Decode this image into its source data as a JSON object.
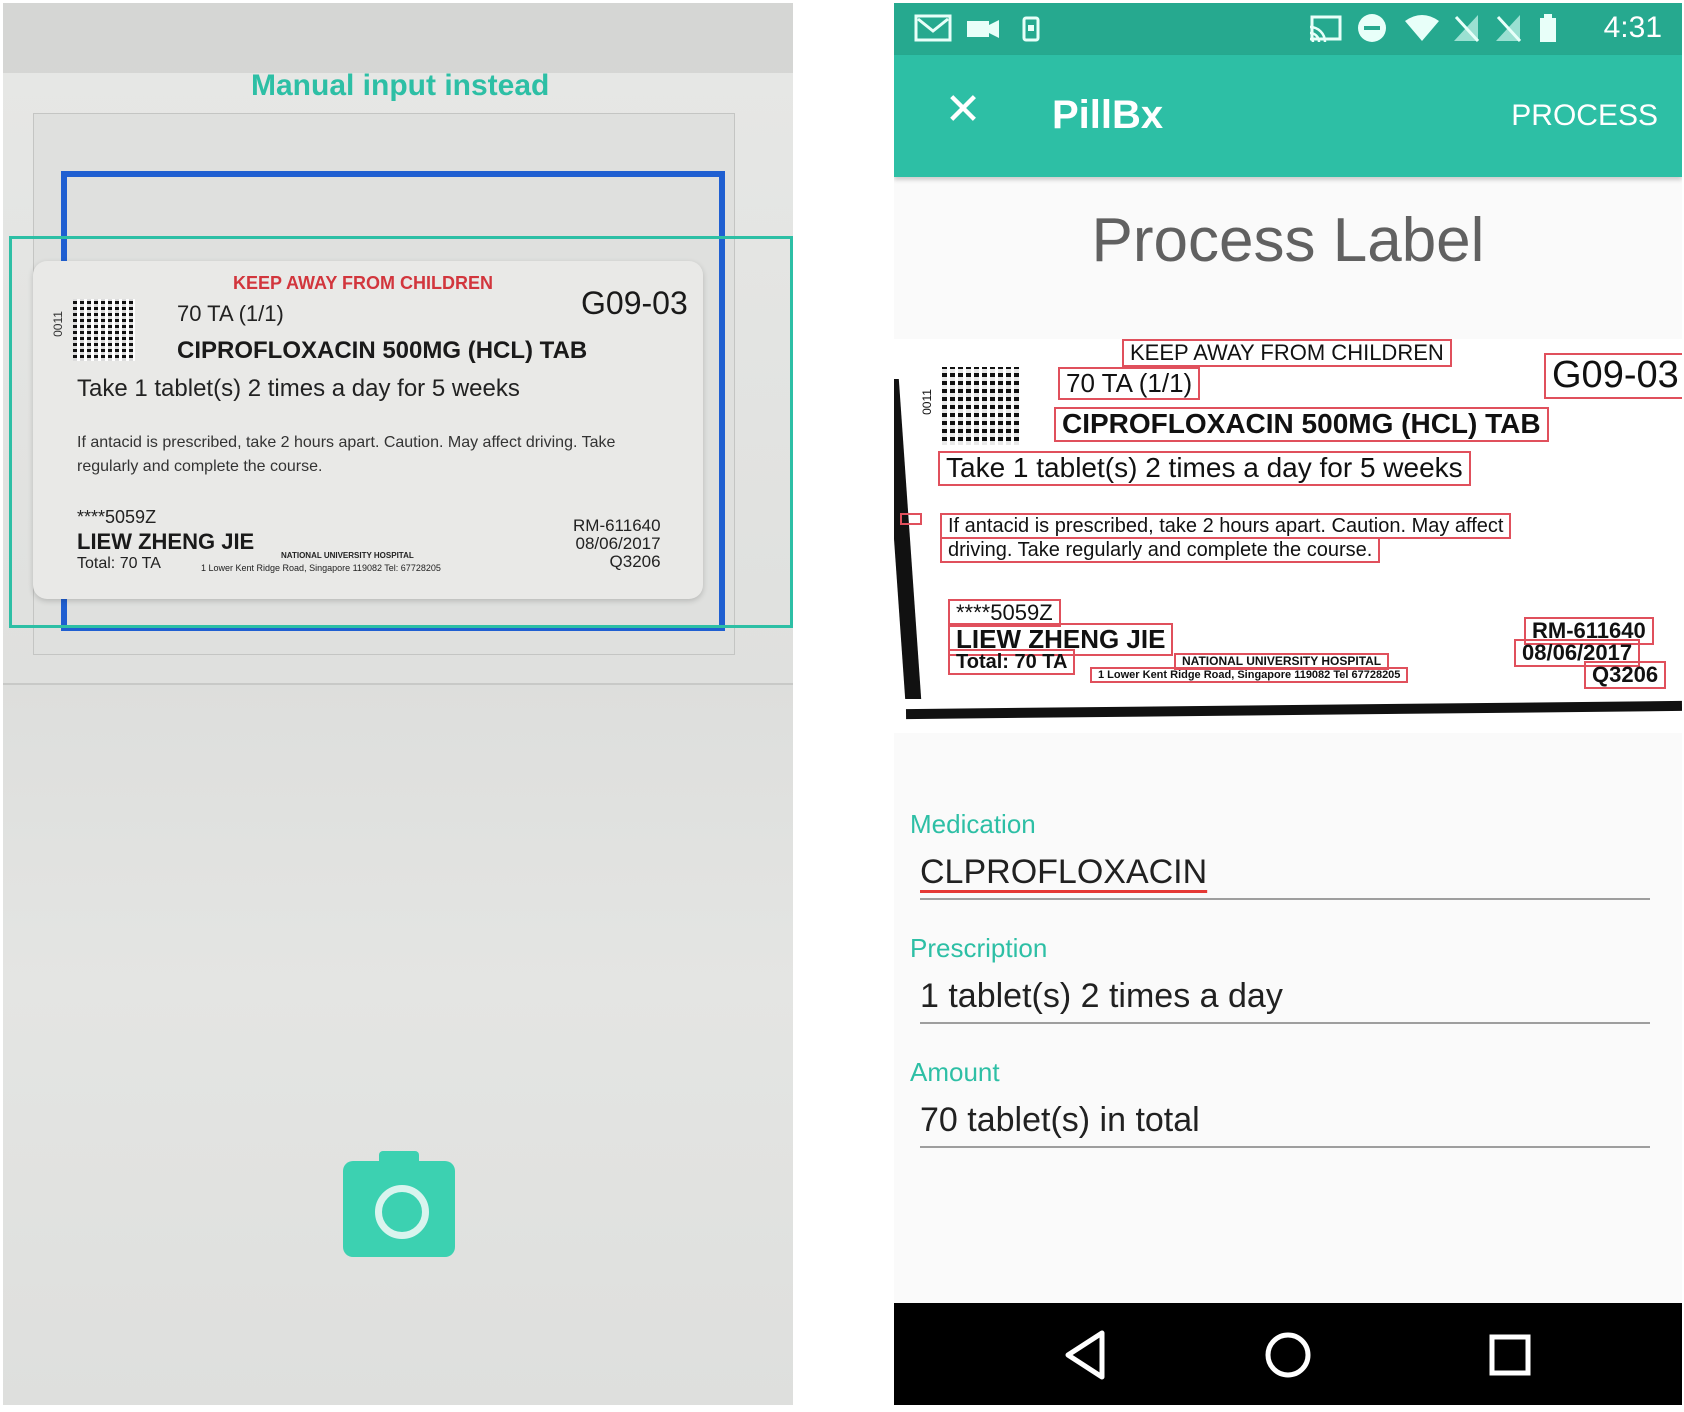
{
  "camera_screen": {
    "manual_input_link": "Manual input instead",
    "shutter_icon": "camera-icon",
    "label": {
      "warning": "KEEP AWAY FROM CHILDREN",
      "side_code": "0011",
      "quantity": "70 TA (1/1)",
      "code": "G09-03",
      "drug": "CIPROFLOXACIN 500MG (HCL) TAB",
      "dosage": "Take 1 tablet(s) 2 times a day for 5 weeks",
      "note": "If antacid is prescribed, take 2 hours apart. Caution. May affect driving. Take regularly and complete the course.",
      "patient_id": "****5059Z",
      "patient_name": "LIEW ZHENG JIE",
      "total": "Total: 70 TA",
      "hospital": "NATIONAL UNIVERSITY HOSPITAL",
      "address": "1 Lower Kent Ridge Road, Singapore 119082 Tel: 67728205",
      "rm": "RM-611640",
      "date": "08/06/2017",
      "ref": "Q3206"
    }
  },
  "app_screen": {
    "status_bar": {
      "time": "4:31",
      "icons": [
        "gmail-icon",
        "video-icon",
        "vibrate-icon",
        "cast-icon",
        "dnd-icon",
        "wifi-icon",
        "no-signal-icon",
        "no-sim-icon",
        "battery-icon"
      ]
    },
    "app_bar": {
      "close_icon": "close-icon",
      "title": "PillBx",
      "action": "PROCESS"
    },
    "page_title": "Process Label",
    "scanned_label": {
      "warning": "KEEP AWAY FROM CHILDREN",
      "side_code": "0011",
      "quantity": "70 TA (1/1)",
      "code": "G09-03",
      "drug": "CIPROFLOXACIN 500MG (HCL) TAB",
      "dosage": "Take 1 tablet(s) 2 times a day for 5 weeks",
      "note_line1": "If antacid is prescribed, take 2 hours apart. Caution. May affect",
      "note_line2": "driving. Take regularly and complete the course.",
      "patient_id": "****5059Z",
      "patient_name": "LIEW ZHENG JIE",
      "total": "Total: 70 TA",
      "hospital": "NATIONAL UNIVERSITY HOSPITAL",
      "address": "1 Lower Kent Ridge Road, Singapore 119082 Tel 67728205",
      "rm": "RM-611640",
      "date": "08/06/2017",
      "ref": "Q3206"
    },
    "form": {
      "medication_label": "Medication",
      "medication_value": "CLPROFLOXACIN",
      "prescription_label": "Prescription",
      "prescription_value": "1 tablet(s) 2 times a day",
      "amount_label": "Amount",
      "amount_value": "70 tablet(s) in total"
    },
    "nav_bar": [
      "back-icon",
      "home-icon",
      "recents-icon"
    ]
  },
  "colors": {
    "accent": "#2dbfa5",
    "status_bar": "#26a98f",
    "ocr_box": "#e0505c",
    "scan_frame": "#1f5fd1"
  }
}
